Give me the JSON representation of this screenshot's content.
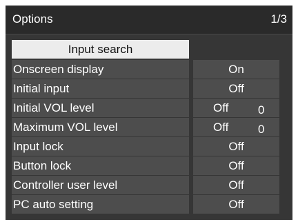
{
  "header": {
    "title": "Options",
    "page": "1/3"
  },
  "search_button": {
    "label": "Input search"
  },
  "rows": [
    {
      "label": "Onscreen display",
      "value": "On"
    },
    {
      "label": "Initial input",
      "value": "Off"
    },
    {
      "label": "Initial VOL level",
      "value": "Off",
      "value2": "0"
    },
    {
      "label": "Maximum VOL level",
      "value": "Off",
      "value2": "0"
    },
    {
      "label": "Input lock",
      "value": "Off"
    },
    {
      "label": "Button lock",
      "value": "Off"
    },
    {
      "label": "Controller user level",
      "value": "Off"
    },
    {
      "label": "PC auto setting",
      "value": "Off"
    }
  ],
  "colors": {
    "background": "#363636",
    "row": "#4d4d4d",
    "selected": "#ececec"
  }
}
